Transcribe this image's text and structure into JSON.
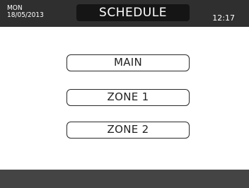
{
  "header": {
    "day": "MON",
    "date": "18/05/2013",
    "title": "SCHEDULE",
    "time": "12:17"
  },
  "menu": {
    "items": [
      {
        "label": "MAIN"
      },
      {
        "label": "ZONE 1"
      },
      {
        "label": "ZONE 2"
      }
    ]
  },
  "colors": {
    "topbar": "#2f2f2f",
    "title_pill": "#151515",
    "bottombar": "#444444",
    "background": "#ffffff"
  }
}
